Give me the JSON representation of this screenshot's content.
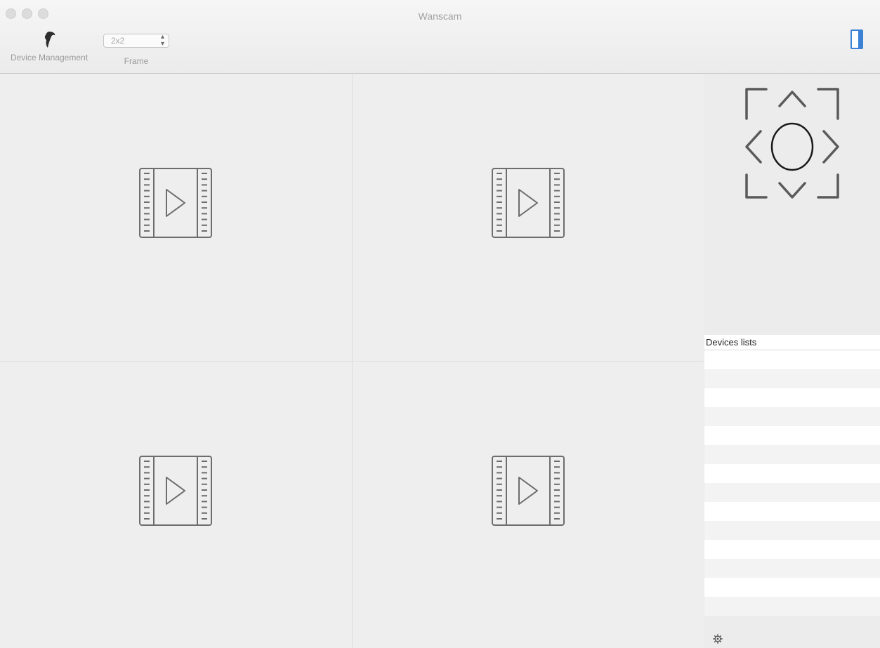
{
  "window": {
    "title": "Wanscam"
  },
  "toolbar": {
    "device_management": {
      "label": "Device Management",
      "icon": "dolphin-logo-icon"
    },
    "frame": {
      "label": "Frame",
      "selected": "2x2"
    }
  },
  "video_grid": {
    "layout": "2x2",
    "cells": [
      {
        "icon": "video-film-play-icon"
      },
      {
        "icon": "video-film-play-icon"
      },
      {
        "icon": "video-film-play-icon"
      },
      {
        "icon": "video-film-play-icon"
      }
    ]
  },
  "ptz_controls": [
    "up-left",
    "up",
    "up-right",
    "left",
    "center",
    "right",
    "down-left",
    "down",
    "down-right"
  ],
  "devices": {
    "header": "Devices lists",
    "items": []
  },
  "colors": {
    "background": "#ececec",
    "icon_stroke": "#6d6d6d",
    "sidebar_toggle": "#3b82d6"
  }
}
